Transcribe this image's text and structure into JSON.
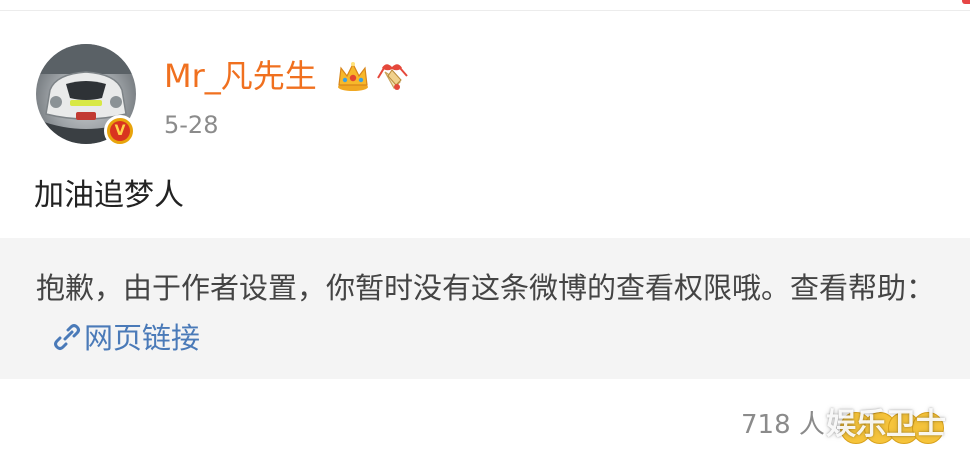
{
  "author": {
    "name": "Mr_凡先生",
    "verified_badge": "V",
    "avatar_icon": "car-avatar",
    "badges": [
      "crown-icon",
      "gift-bell-icon"
    ]
  },
  "post": {
    "date": "5-28",
    "text": "加油追梦人"
  },
  "notice": {
    "message": "抱歉，由于作者设置，你暂时没有这条微博的查看权限哦。查看帮助：",
    "link_label": "网页链接",
    "link_icon": "link-icon"
  },
  "footer": {
    "read_count": "718 人",
    "watermark": "娱乐卫士"
  },
  "colors": {
    "username": "#f0701f",
    "link": "#4a7ab8",
    "notice_bg": "#f4f4f4",
    "badge": "#e8a40c"
  }
}
